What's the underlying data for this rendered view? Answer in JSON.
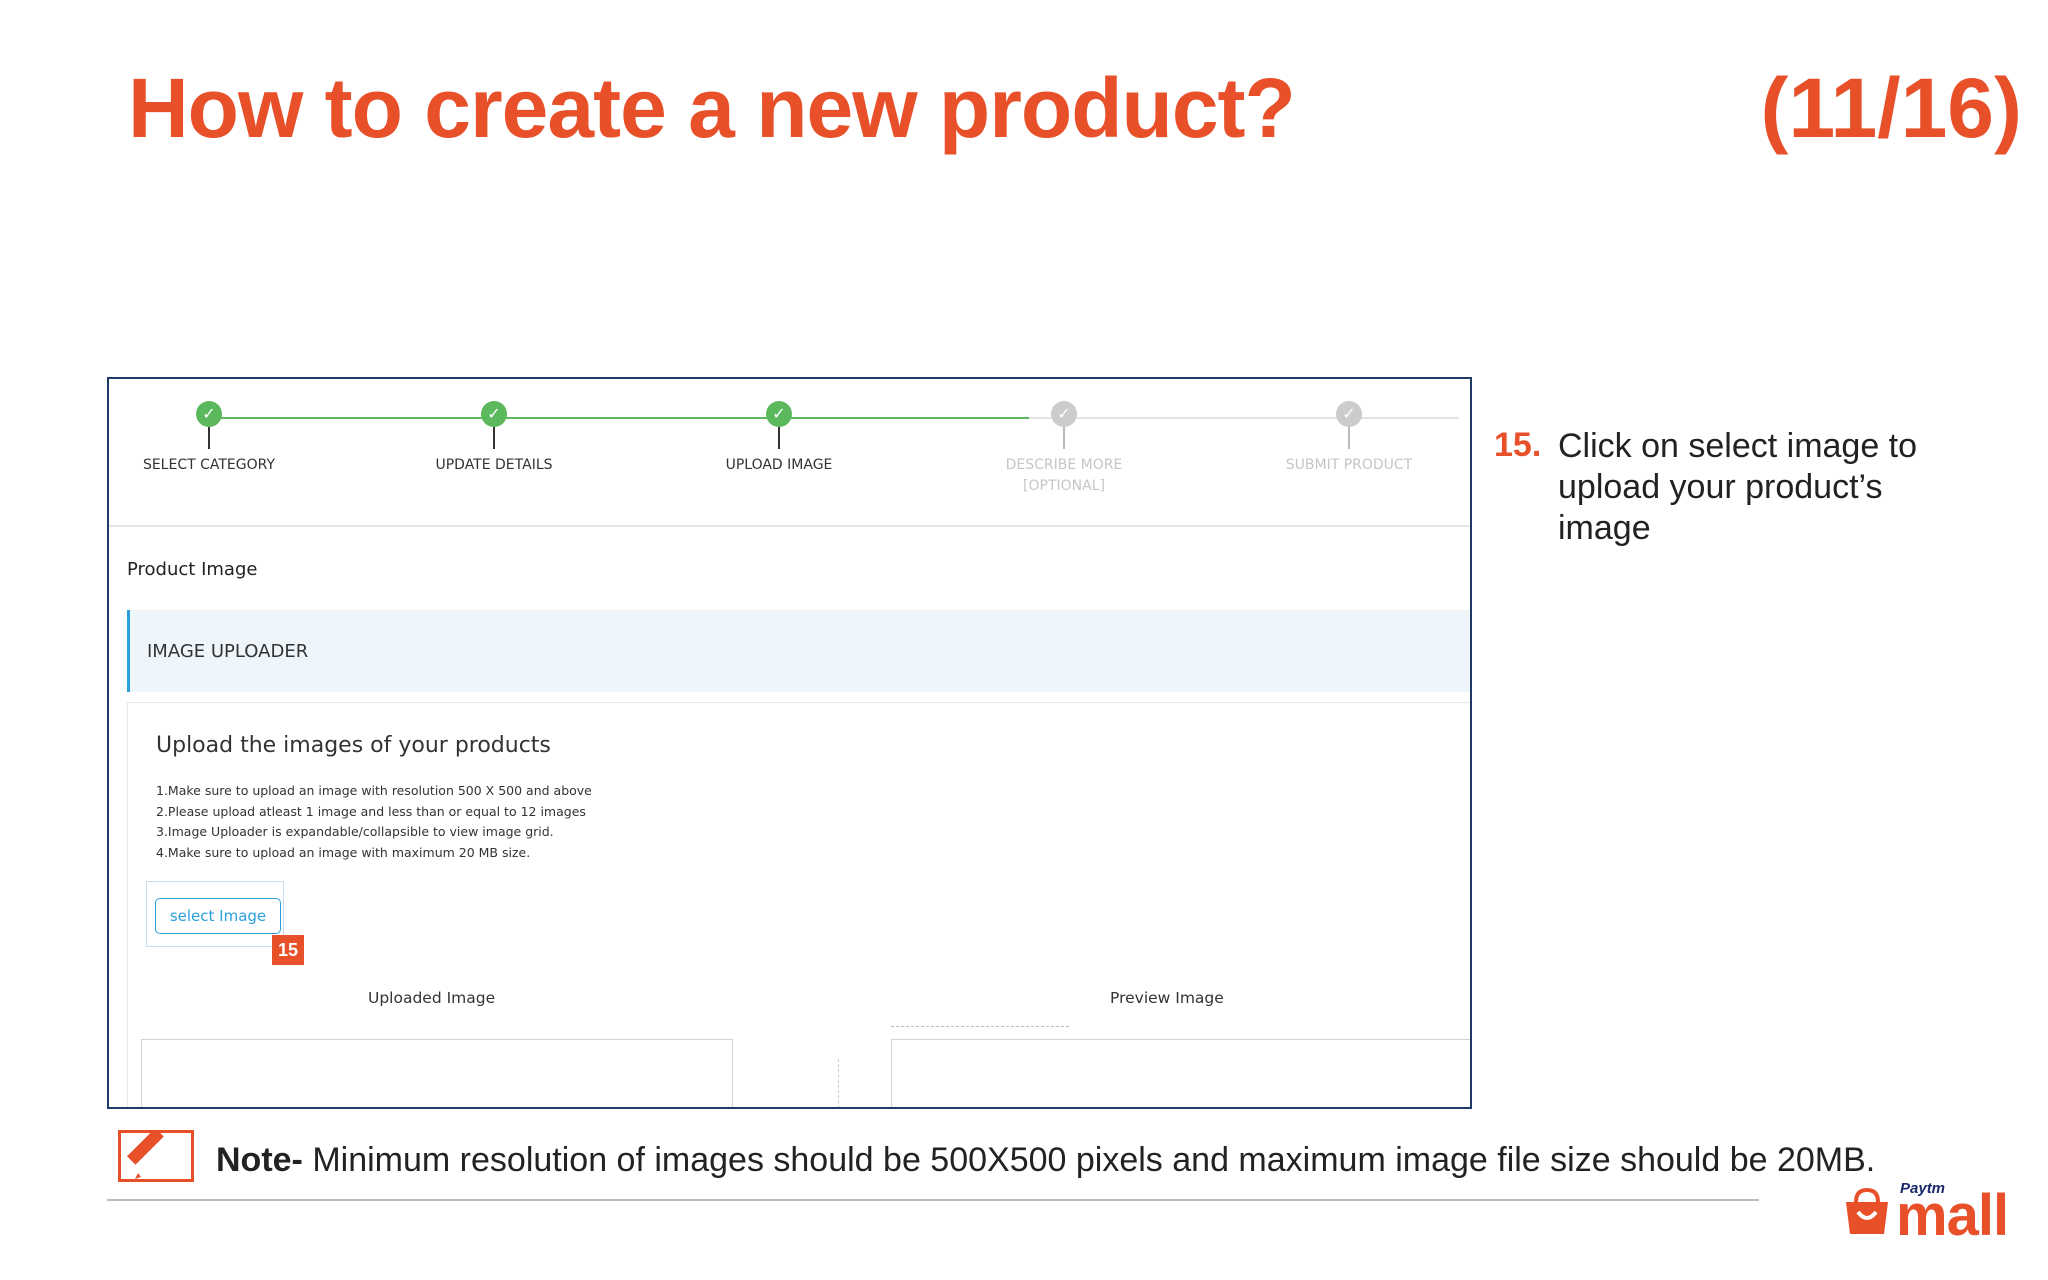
{
  "slide": {
    "title": "How to create a new product?",
    "counter": "(11/16)"
  },
  "stepper": {
    "steps": [
      {
        "label": "SELECT CATEGORY",
        "sublabel": "",
        "state": "done"
      },
      {
        "label": "UPDATE DETAILS",
        "sublabel": "",
        "state": "done"
      },
      {
        "label": "UPLOAD IMAGE",
        "sublabel": "",
        "state": "done"
      },
      {
        "label": "DESCRIBE MORE",
        "sublabel": "[OPTIONAL]",
        "state": "pending"
      },
      {
        "label": "SUBMIT PRODUCT",
        "sublabel": "",
        "state": "pending"
      }
    ],
    "done_color": "#5cb85c",
    "pending_color": "#cccccc",
    "check_glyph": "✓"
  },
  "section_title": "Product Image",
  "accordion_label": "IMAGE UPLOADER",
  "uploader": {
    "heading": "Upload the images of your products",
    "rules": [
      "1.Make sure to upload an image with resolution 500 X 500 and above",
      "2.Please upload atleast 1 image and less than or equal to 12 images",
      "3.Image Uploader is expandable/collapsible to view image grid.",
      "4.Make sure to upload an image with maximum 20 MB size."
    ],
    "select_button": "select Image",
    "step_badge": "15",
    "uploaded_label": "Uploaded Image",
    "preview_label": "Preview Image"
  },
  "instruction": {
    "number": "15.",
    "text": "Click on select image to upload your product’s image"
  },
  "note": {
    "prefix": "Note-",
    "text": " Minimum resolution of images should be 500X500 pixels and maximum  image file size should be 20MB.",
    "icon": "pencil-note-icon"
  },
  "brand": {
    "small": "Paytm",
    "large": "mall",
    "icon": "shopping-bag-icon"
  },
  "colors": {
    "accent": "#e8502a",
    "frame": "#1f3a68",
    "link": "#2aa0dc"
  }
}
